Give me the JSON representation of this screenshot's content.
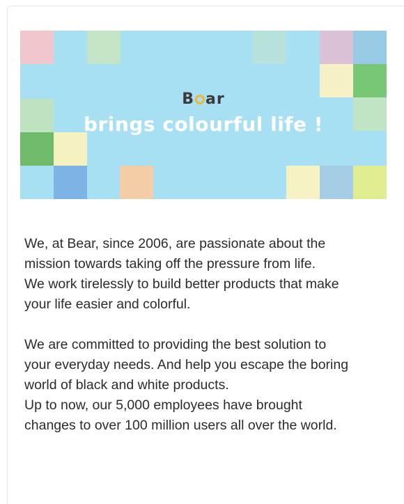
{
  "banner": {
    "brand": "Bear",
    "brand_left": "B",
    "brand_right": "ar",
    "slogan": "brings colourful life !",
    "background": "#a7dff3",
    "tile_colors": [
      "#f2c6cd",
      "#c4e4c8",
      "#b9e1dc",
      "#dbc1d6",
      "#98cce4",
      "#f6f0c6",
      "#78c776",
      "#c1e5c4",
      "#bfe3c1",
      "#6fbb6a",
      "#f5f1c1",
      "#7db3e6",
      "#f2cda5",
      "#f7f2c4",
      "#a4cde5",
      "#e2ec91"
    ]
  },
  "paragraphs": [
    {
      "lines": [
        "We, at Bear, since 2006, are passionate about the",
        "mission towards taking off the pressure from life.",
        "We work tirelessly to build better products that make",
        "your life easier and colorful."
      ]
    },
    {
      "lines": [
        "We are committed to providing the best solution to",
        "your everyday needs. And help you escape the boring",
        "world of black and white products.",
        "Up to now, our 5,000 employees have brought",
        "changes to over 100 million users all over the world."
      ]
    }
  ]
}
